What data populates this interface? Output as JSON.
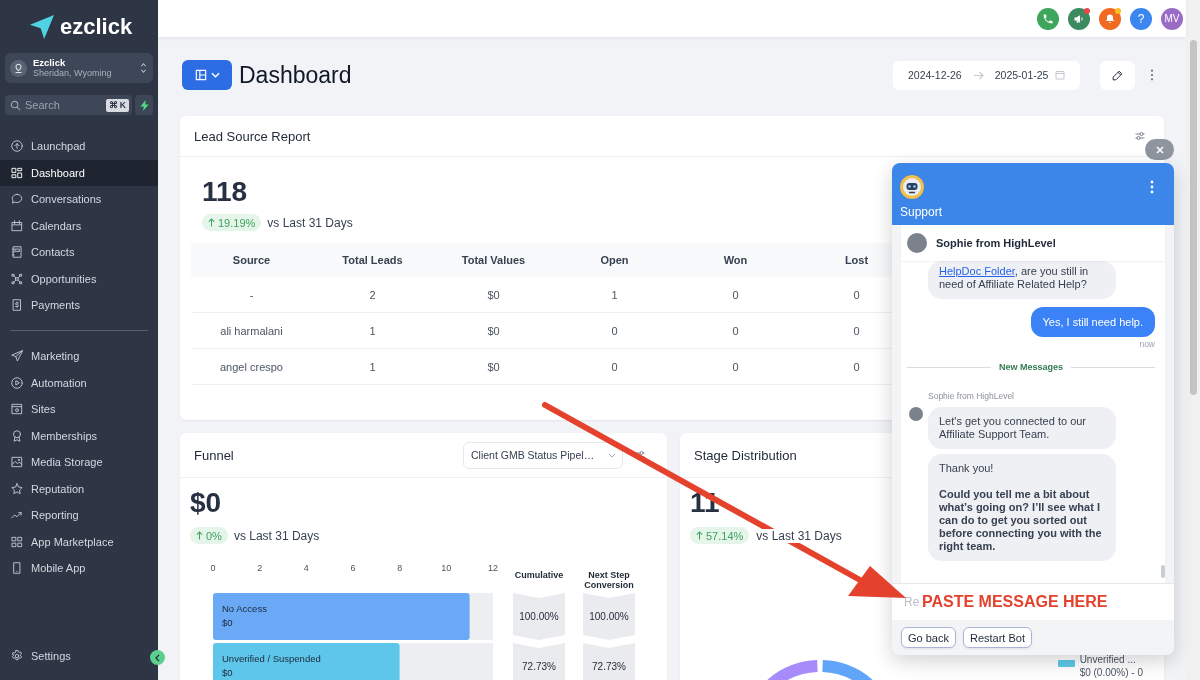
{
  "sidebar": {
    "brand": "ezclick",
    "account": {
      "name": "Ezclick",
      "location": "Sheridan, Wyoming"
    },
    "search": {
      "placeholder": "Search",
      "shortcut": "⌘ K"
    },
    "primary_items": [
      {
        "label": "Launchpad",
        "selected": false
      },
      {
        "label": "Dashboard",
        "selected": true
      },
      {
        "label": "Conversations",
        "selected": false
      },
      {
        "label": "Calendars",
        "selected": false
      },
      {
        "label": "Contacts",
        "selected": false
      },
      {
        "label": "Opportunities",
        "selected": false
      },
      {
        "label": "Payments",
        "selected": false
      }
    ],
    "secondary_items": [
      {
        "label": "Marketing",
        "selected": false
      },
      {
        "label": "Automation",
        "selected": false
      },
      {
        "label": "Sites",
        "selected": false
      },
      {
        "label": "Memberships",
        "selected": false
      },
      {
        "label": "Media Storage",
        "selected": false
      },
      {
        "label": "Reputation",
        "selected": false
      },
      {
        "label": "Reporting",
        "selected": false
      },
      {
        "label": "App Marketplace",
        "selected": false
      },
      {
        "label": "Mobile App",
        "selected": false
      }
    ],
    "footer_item": {
      "label": "Settings",
      "selected": false
    }
  },
  "top_bar": {
    "announcements_unread": true,
    "notifications_unread": true,
    "help_label": "?",
    "avatar_initials": "MV"
  },
  "page": {
    "title": "Dashboard",
    "date_from": "2024-12-26",
    "date_to": "2025-01-25"
  },
  "lead_source_report": {
    "title": "Lead Source Report",
    "total": "118",
    "change": "19.19%",
    "comparison": "vs Last 31 Days",
    "table": {
      "columns": [
        "Source",
        "Total Leads",
        "Total Values",
        "Open",
        "Won",
        "Lost"
      ],
      "rows": [
        [
          "-",
          "2",
          "$0",
          "1",
          "0",
          "0"
        ],
        [
          "ali harmalani",
          "1",
          "$0",
          "0",
          "0",
          "0"
        ],
        [
          "angel crespo",
          "1",
          "$0",
          "0",
          "0",
          "0"
        ]
      ]
    }
  },
  "funnel": {
    "title": "Funnel",
    "pipeline": "Client GMB Status Pipel…",
    "total": "$0",
    "change": "0%",
    "comparison": "vs Last 31 Days",
    "chart_data": {
      "type": "bar",
      "orientation": "horizontal",
      "categories": [
        "No Access",
        "Unverified / Suspended"
      ],
      "values": [
        11,
        8
      ],
      "xlim": [
        0,
        12
      ],
      "xticks": [
        0,
        2,
        4,
        6,
        8,
        10,
        12
      ]
    },
    "stage_amounts": [
      "$0",
      "$0"
    ],
    "cumulative_heading": "Cumulative",
    "conversion_heading": "Next Step Conversion",
    "cumulative": [
      "100.00%",
      "72.73%"
    ],
    "conversion": [
      "100.00%",
      "72.73%"
    ]
  },
  "stage_distribution": {
    "title": "Stage Distribution",
    "total": "11",
    "change": "57.14%",
    "comparison": "vs Last 31 Days",
    "legend": [
      {
        "label": "Unverified ...",
        "value": "$0 (0.00%) - 0",
        "color": "#5ec8ea"
      }
    ]
  },
  "support_chat": {
    "title": "Support",
    "agent": "Sophie from HighLevel",
    "messages": [
      {
        "kind": "bot",
        "avatar": false,
        "paragraphs": [
          {
            "link": "HelpDoc Folder",
            "text": ", are you still in need of Affiliate Related Help?",
            "bold": false
          }
        ]
      },
      {
        "kind": "user",
        "text": "Yes, I still need help.",
        "time": "now"
      },
      {
        "kind": "divider",
        "text": "New Messages"
      },
      {
        "kind": "sender",
        "text": "Sophie from HighLevel"
      },
      {
        "kind": "bot",
        "avatar": true,
        "paragraphs": [
          {
            "text": "Let's get you connected to our Affiliate Support Team.",
            "bold": false
          }
        ]
      },
      {
        "kind": "bot",
        "avatar": false,
        "paragraphs": [
          {
            "text": "Thank you!",
            "bold": false
          },
          {
            "text": "Could you tell me a bit about what’s going on? I’ll see what I can do to get you sorted out before connecting you with the right team.",
            "bold": true
          }
        ]
      }
    ],
    "composer": {
      "placeholder": "Re"
    },
    "buttons": [
      "Go back",
      "Restart Bot"
    ]
  },
  "annotation": {
    "text": "PASTE MESSAGE HERE"
  }
}
